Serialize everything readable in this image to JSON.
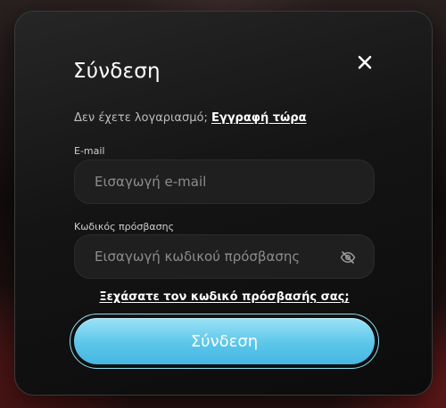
{
  "modal": {
    "title": "Σύνδεση",
    "close_icon": "close-icon"
  },
  "signup": {
    "prompt": "Δεν έχετε λογαριασμό; ",
    "link": "Εγγραφή τώρα"
  },
  "email": {
    "label": "E-mail",
    "placeholder": "Εισαγωγή e-mail",
    "value": ""
  },
  "password": {
    "label": "Κωδικός πρόσβασης",
    "placeholder": "Εισαγωγή κωδικού πρόσβασης",
    "value": "",
    "toggle_icon": "eye-off-icon"
  },
  "forgot_link": "Ξεχάσατε τον κωδικό πρόσβασής σας;",
  "submit_label": "Σύνδεση",
  "colors": {
    "accent": "#5cc6ea",
    "modal_bg": "#141414"
  }
}
